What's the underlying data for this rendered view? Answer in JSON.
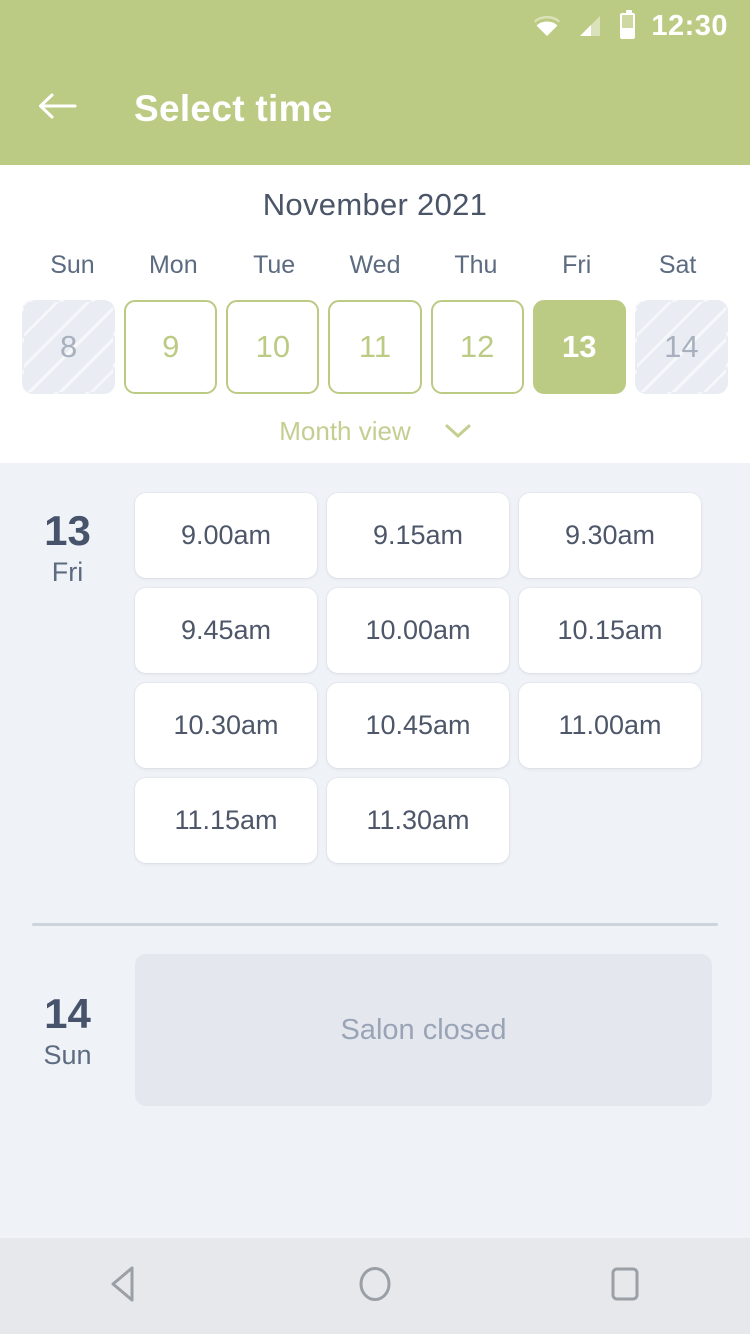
{
  "status_bar": {
    "time": "12:30",
    "icons": [
      "wifi-icon",
      "cellular-signal-icon",
      "battery-icon"
    ]
  },
  "app_bar": {
    "back_icon": "arrow-left-icon",
    "title": "Select time"
  },
  "calendar": {
    "month_title": "November 2021",
    "weekdays": [
      "Sun",
      "Mon",
      "Tue",
      "Wed",
      "Thu",
      "Fri",
      "Sat"
    ],
    "dates": [
      {
        "day": "8",
        "state": "disabled"
      },
      {
        "day": "9",
        "state": "available"
      },
      {
        "day": "10",
        "state": "available"
      },
      {
        "day": "11",
        "state": "available"
      },
      {
        "day": "12",
        "state": "available"
      },
      {
        "day": "13",
        "state": "selected"
      },
      {
        "day": "14",
        "state": "disabled"
      }
    ],
    "month_view_label": "Month view",
    "month_view_icon": "chevron-down-icon"
  },
  "schedule": [
    {
      "day_number": "13",
      "day_of_week": "Fri",
      "slots": [
        "9.00am",
        "9.15am",
        "9.30am",
        "9.45am",
        "10.00am",
        "10.15am",
        "10.30am",
        "10.45am",
        "11.00am",
        "11.15am",
        "11.30am"
      ],
      "closed_message": null
    },
    {
      "day_number": "14",
      "day_of_week": "Sun",
      "slots": [],
      "closed_message": "Salon closed"
    }
  ],
  "nav_bar": {
    "back_icon": "triangle-back-icon",
    "home_icon": "circle-home-icon",
    "recents_icon": "square-recents-icon"
  },
  "colors": {
    "accent": "#bccb84",
    "body_bg": "#eff2f7",
    "text_dark": "#46536b",
    "text_muted": "#9aa4b6"
  }
}
